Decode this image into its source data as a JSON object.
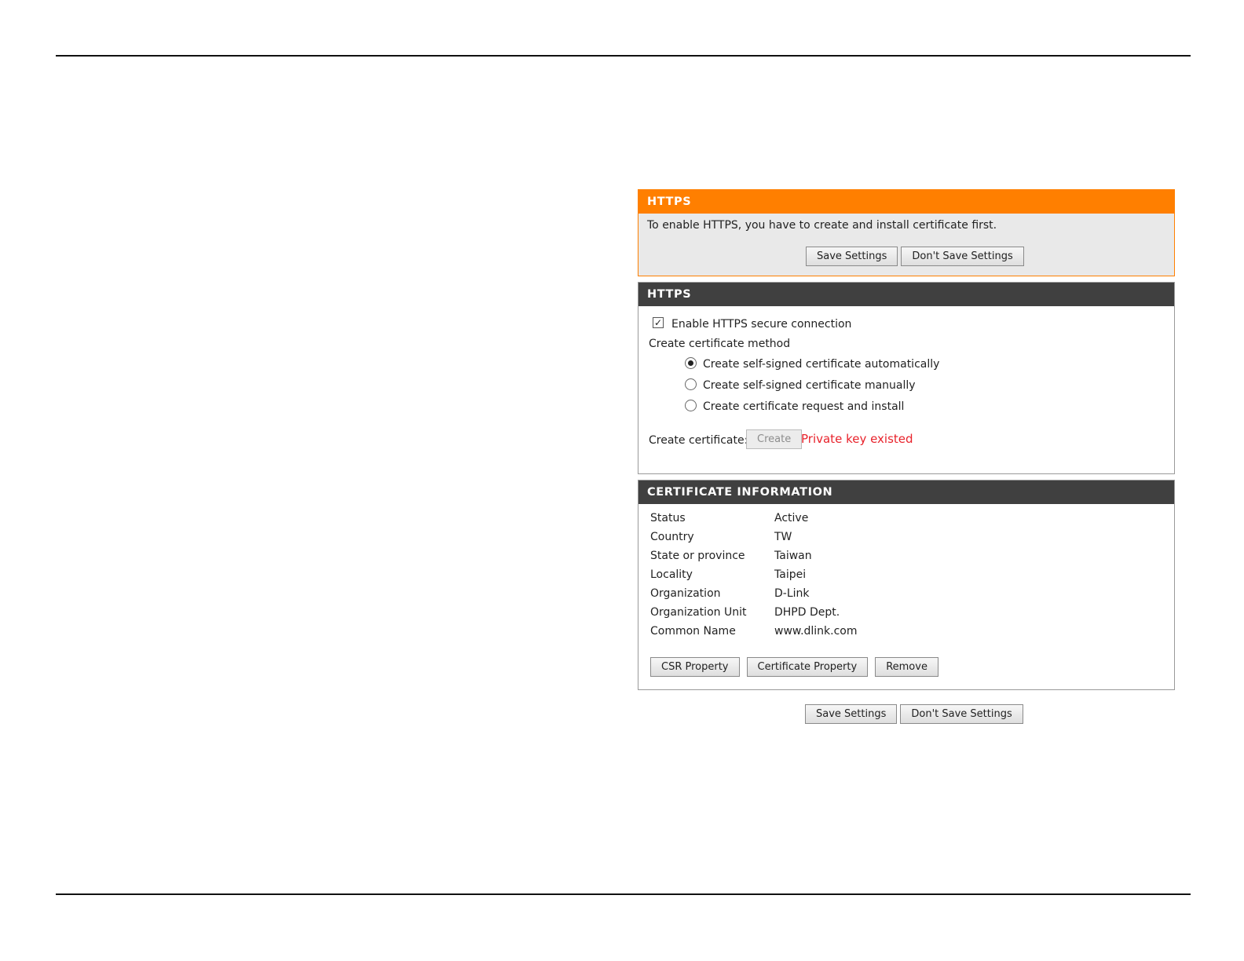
{
  "notice_panel": {
    "title": "HTTPS",
    "message": "To enable HTTPS, you have to create and install certificate first.",
    "save_label": "Save Settings",
    "dont_save_label": "Don't Save Settings"
  },
  "https_panel": {
    "title": "HTTPS",
    "enable_label": "Enable HTTPS secure connection",
    "enable_checked": true,
    "method_label": "Create certificate method",
    "methods": [
      {
        "label": "Create self-signed certificate automatically",
        "selected": true
      },
      {
        "label": "Create self-signed certificate manually",
        "selected": false
      },
      {
        "label": "Create certificate request and install",
        "selected": false
      }
    ],
    "create_label": "Create certificate:",
    "create_button": "Create",
    "create_status": "Private key existed"
  },
  "cert_panel": {
    "title": "CERTIFICATE INFORMATION",
    "rows": [
      {
        "label": "Status",
        "value": "Active"
      },
      {
        "label": "Country",
        "value": "TW"
      },
      {
        "label": "State or province",
        "value": "Taiwan"
      },
      {
        "label": "Locality",
        "value": "Taipei"
      },
      {
        "label": "Organization",
        "value": "D-Link"
      },
      {
        "label": "Organization Unit",
        "value": "DHPD Dept."
      },
      {
        "label": "Common Name",
        "value": "www.dlink.com"
      }
    ],
    "csr_button": "CSR Property",
    "cert_button": "Certificate Property",
    "remove_button": "Remove"
  },
  "footer_buttons": {
    "save_label": "Save Settings",
    "dont_save_label": "Don't Save Settings"
  },
  "colors": {
    "accent_orange": "#ff7f00",
    "header_dark": "#404040",
    "error_red": "#e8222b"
  }
}
